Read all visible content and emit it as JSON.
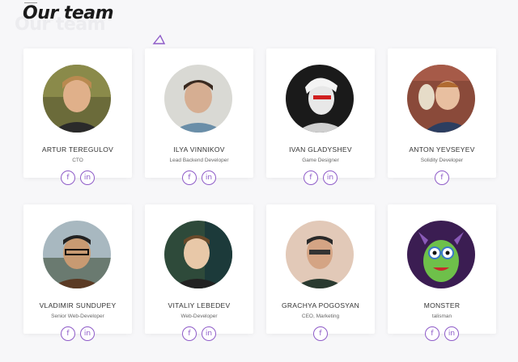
{
  "page": {
    "title": "Our team"
  },
  "team": [
    {
      "name": "ARTUR TEREGULOV",
      "role": "CTO",
      "socials": [
        "f",
        "in"
      ]
    },
    {
      "name": "ILYA VINNIKOV",
      "role": "Lead Backend Developer",
      "socials": [
        "f",
        "in"
      ]
    },
    {
      "name": "IVAN GLADYSHEV",
      "role": "Game Designer",
      "socials": [
        "f",
        "in"
      ]
    },
    {
      "name": "ANTON YEVSEYEV",
      "role": "Solidity Developer",
      "socials": [
        "f"
      ]
    },
    {
      "name": "VLADIMIR SUNDUPEY",
      "role": "Senior Web-Developer",
      "socials": [
        "f",
        "in"
      ]
    },
    {
      "name": "VITALIY LEBEDEV",
      "role": "Web-Developer",
      "socials": [
        "f",
        "in"
      ]
    },
    {
      "name": "GRACHYA POGOSYAN",
      "role": "CEO, Marketing",
      "socials": [
        "f"
      ]
    },
    {
      "name": "MONSTER",
      "role": "talisman",
      "socials": [
        "f",
        "in"
      ]
    }
  ],
  "colors": {
    "accent": "#8e5bc8",
    "card_bg": "#ffffff",
    "page_bg": "#f7f7f9"
  },
  "icons": {
    "f": "facebook-icon",
    "in": "linkedin-icon"
  }
}
